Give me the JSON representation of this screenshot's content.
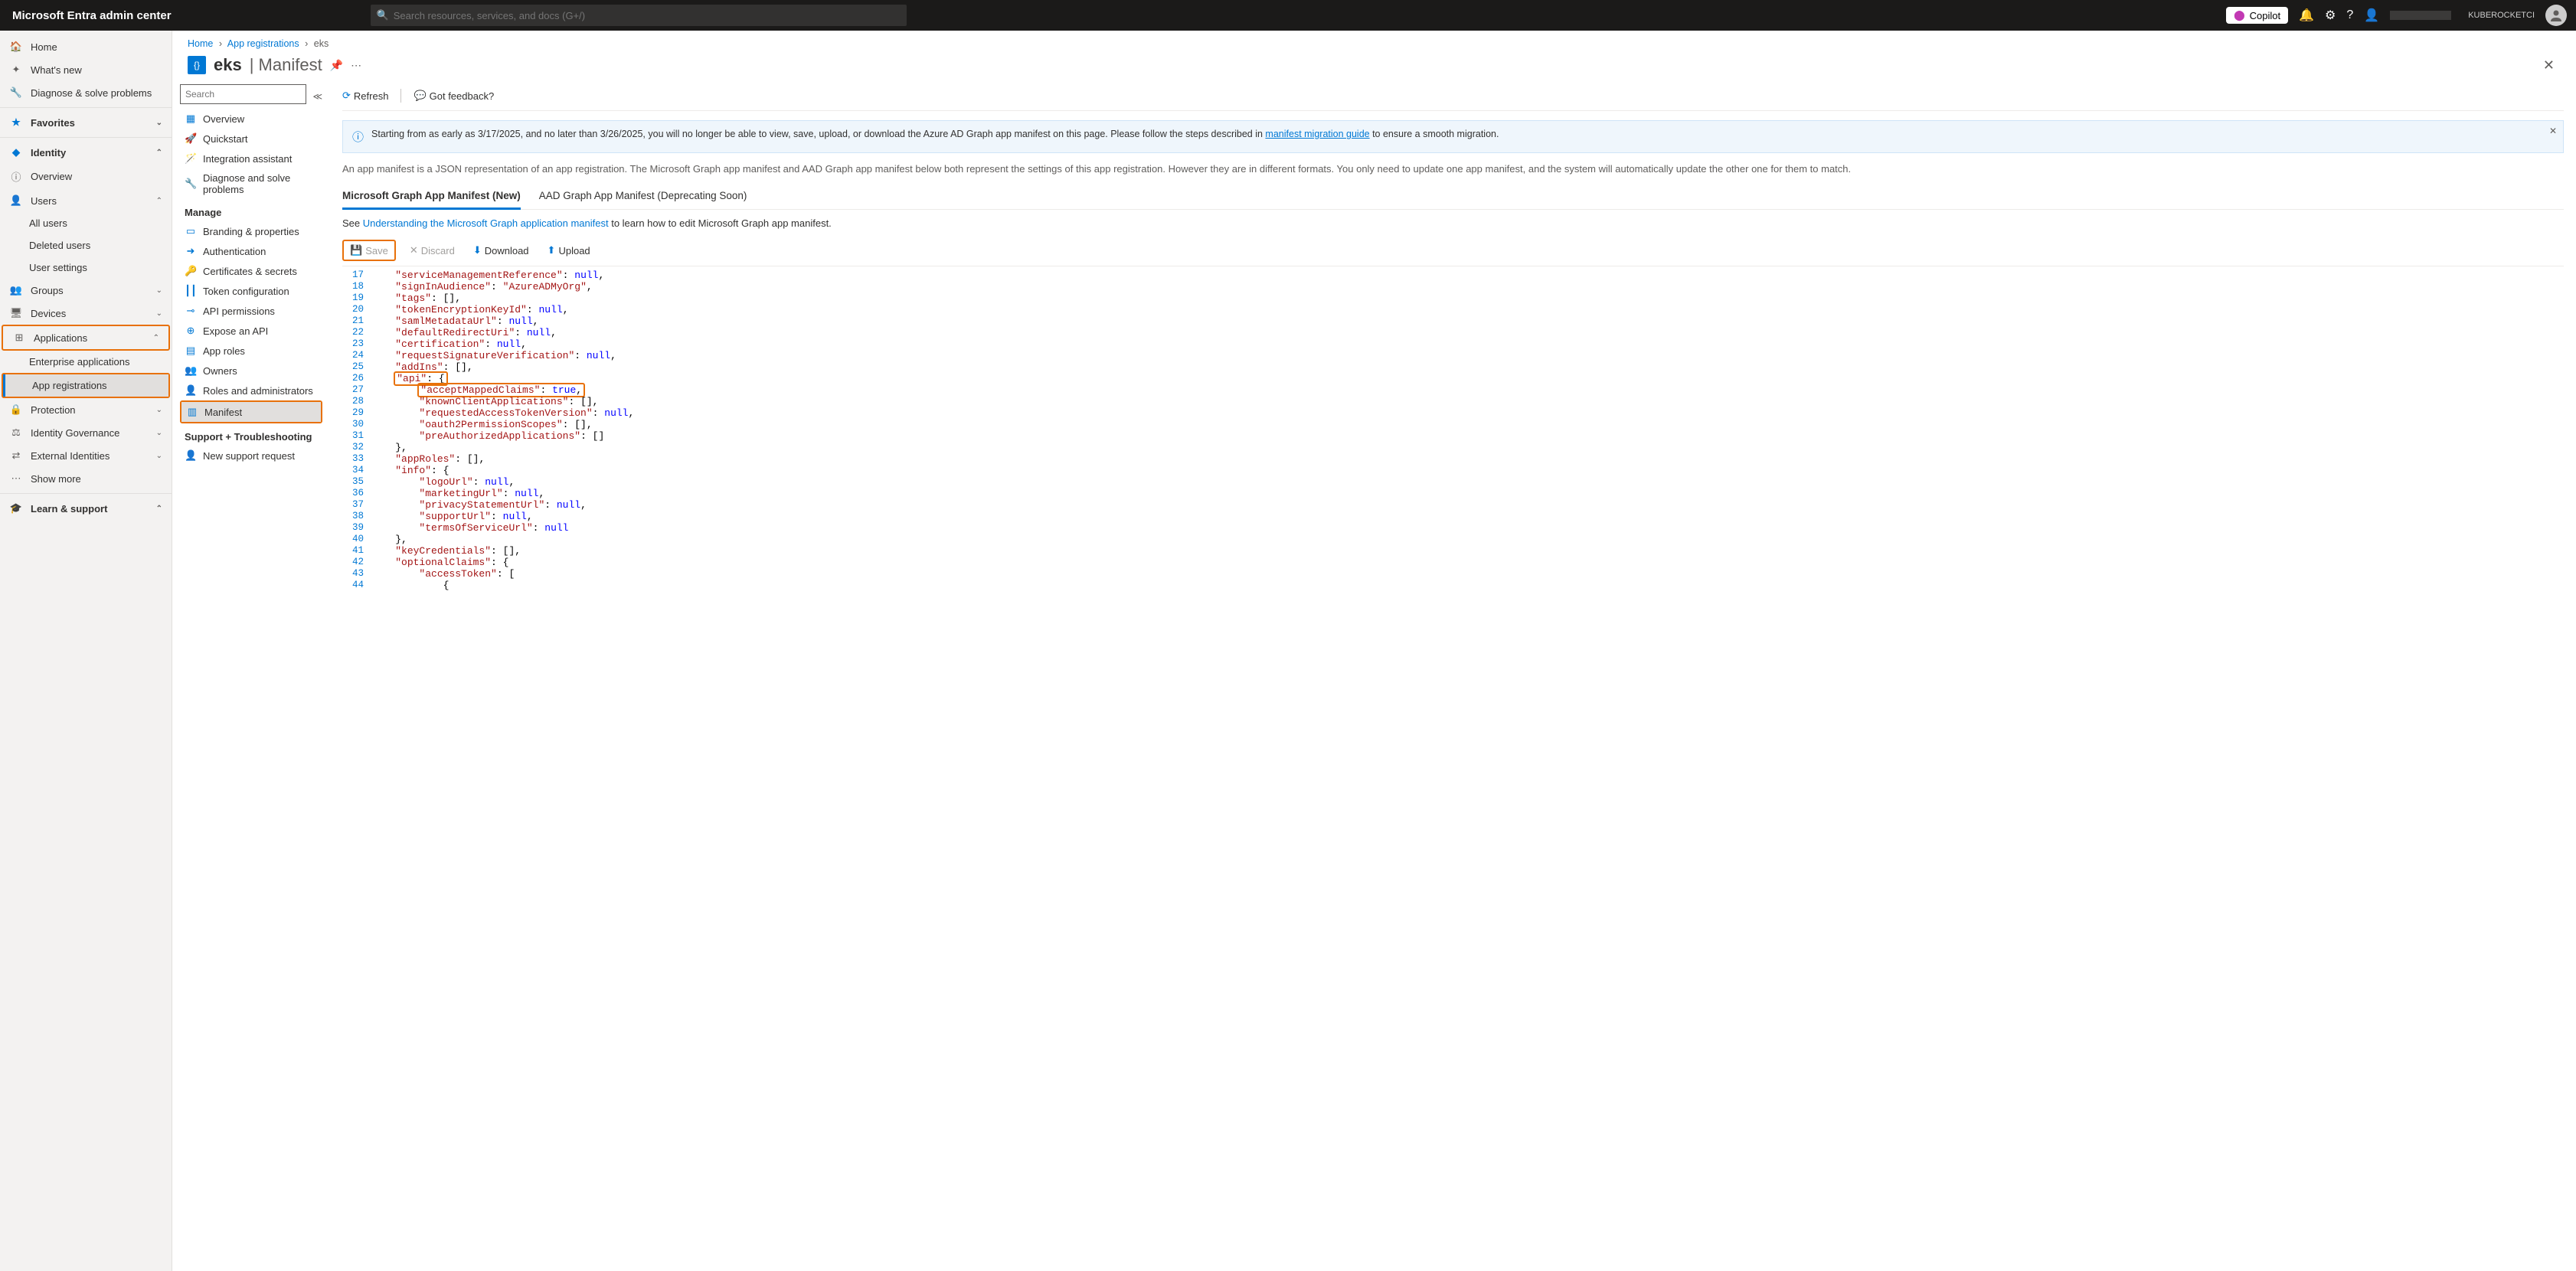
{
  "topbar": {
    "brand": "Microsoft Entra admin center",
    "search_placeholder": "Search resources, services, and docs (G+/)",
    "copilot": "Copilot",
    "tenant": "KUBEROCKETCI"
  },
  "sidebar": {
    "home": "Home",
    "whats_new": "What's new",
    "diagnose": "Diagnose & solve problems",
    "favorites": "Favorites",
    "identity": "Identity",
    "overview": "Overview",
    "users": "Users",
    "users_all": "All users",
    "users_deleted": "Deleted users",
    "users_settings": "User settings",
    "groups": "Groups",
    "devices": "Devices",
    "applications": "Applications",
    "enterprise_apps": "Enterprise applications",
    "app_registrations": "App registrations",
    "protection": "Protection",
    "identity_governance": "Identity Governance",
    "external_identities": "External Identities",
    "show_more": "Show more",
    "learn_support": "Learn & support"
  },
  "breadcrumb": {
    "home": "Home",
    "app_reg": "App registrations",
    "current": "eks"
  },
  "page": {
    "app_name": "eks",
    "section": "Manifest"
  },
  "mid": {
    "search_placeholder": "Search",
    "overview": "Overview",
    "quickstart": "Quickstart",
    "integration": "Integration assistant",
    "diagnose": "Diagnose and solve problems",
    "manage": "Manage",
    "branding": "Branding & properties",
    "authentication": "Authentication",
    "certs": "Certificates & secrets",
    "token_config": "Token configuration",
    "api_permissions": "API permissions",
    "expose_api": "Expose an API",
    "app_roles": "App roles",
    "owners": "Owners",
    "roles_admins": "Roles and administrators",
    "manifest": "Manifest",
    "support_heading": "Support + Troubleshooting",
    "new_support": "New support request"
  },
  "toolbar_right": {
    "refresh": "Refresh",
    "feedback": "Got feedback?"
  },
  "banner": {
    "text_pre": "Starting from as early as 3/17/2025, and no later than 3/26/2025, you will no longer be able to view, save, upload, or download the Azure AD Graph app manifest on this page. Please follow the steps described in ",
    "link": "manifest migration guide",
    "text_post": " to ensure a smooth migration."
  },
  "desc": "An app manifest is a JSON representation of an app registration. The Microsoft Graph app manifest and AAD Graph app manifest below both represent the settings of this app registration. However they are in different formats. You only need to update one app manifest, and the system will automatically update the other one for them to match.",
  "tabs": {
    "msgraph": "Microsoft Graph App Manifest (New)",
    "aadgraph": "AAD Graph App Manifest (Deprecating Soon)"
  },
  "learn": {
    "pre": "See ",
    "link": "Understanding the Microsoft Graph application manifest",
    "post": " to learn how to edit Microsoft Graph app manifest."
  },
  "editor_toolbar": {
    "save": "Save",
    "discard": "Discard",
    "download": "Download",
    "upload": "Upload"
  },
  "code_lines": [
    {
      "n": 17,
      "i": 1,
      "t": [
        [
          "key",
          "\"serviceManagementReference\""
        ],
        [
          "punc",
          ": "
        ],
        [
          "null",
          "null"
        ],
        [
          "punc",
          ","
        ]
      ]
    },
    {
      "n": 18,
      "i": 1,
      "t": [
        [
          "key",
          "\"signInAudience\""
        ],
        [
          "punc",
          ": "
        ],
        [
          "str",
          "\"AzureADMyOrg\""
        ],
        [
          "punc",
          ","
        ]
      ]
    },
    {
      "n": 19,
      "i": 1,
      "t": [
        [
          "key",
          "\"tags\""
        ],
        [
          "punc",
          ": [],"
        ]
      ]
    },
    {
      "n": 20,
      "i": 1,
      "t": [
        [
          "key",
          "\"tokenEncryptionKeyId\""
        ],
        [
          "punc",
          ": "
        ],
        [
          "null",
          "null"
        ],
        [
          "punc",
          ","
        ]
      ]
    },
    {
      "n": 21,
      "i": 1,
      "t": [
        [
          "key",
          "\"samlMetadataUrl\""
        ],
        [
          "punc",
          ": "
        ],
        [
          "null",
          "null"
        ],
        [
          "punc",
          ","
        ]
      ]
    },
    {
      "n": 22,
      "i": 1,
      "t": [
        [
          "key",
          "\"defaultRedirectUri\""
        ],
        [
          "punc",
          ": "
        ],
        [
          "null",
          "null"
        ],
        [
          "punc",
          ","
        ]
      ]
    },
    {
      "n": 23,
      "i": 1,
      "t": [
        [
          "key",
          "\"certification\""
        ],
        [
          "punc",
          ": "
        ],
        [
          "null",
          "null"
        ],
        [
          "punc",
          ","
        ]
      ]
    },
    {
      "n": 24,
      "i": 1,
      "t": [
        [
          "key",
          "\"requestSignatureVerification\""
        ],
        [
          "punc",
          ": "
        ],
        [
          "null",
          "null"
        ],
        [
          "punc",
          ","
        ]
      ]
    },
    {
      "n": 25,
      "i": 1,
      "t": [
        [
          "key",
          "\"addIns\""
        ],
        [
          "punc",
          ": [],"
        ]
      ]
    },
    {
      "n": 26,
      "i": 1,
      "hl": true,
      "t": [
        [
          "key",
          "\"api\""
        ],
        [
          "punc",
          ": {"
        ]
      ]
    },
    {
      "n": 27,
      "i": 2,
      "hl": true,
      "t": [
        [
          "key",
          "\"acceptMappedClaims\""
        ],
        [
          "punc",
          ": "
        ],
        [
          "bool",
          "true"
        ],
        [
          "punc",
          ","
        ]
      ]
    },
    {
      "n": 28,
      "i": 2,
      "t": [
        [
          "key",
          "\"knownClientApplications\""
        ],
        [
          "punc",
          ": [],"
        ]
      ]
    },
    {
      "n": 29,
      "i": 2,
      "t": [
        [
          "key",
          "\"requestedAccessTokenVersion\""
        ],
        [
          "punc",
          ": "
        ],
        [
          "null",
          "null"
        ],
        [
          "punc",
          ","
        ]
      ]
    },
    {
      "n": 30,
      "i": 2,
      "t": [
        [
          "key",
          "\"oauth2PermissionScopes\""
        ],
        [
          "punc",
          ": [],"
        ]
      ]
    },
    {
      "n": 31,
      "i": 2,
      "t": [
        [
          "key",
          "\"preAuthorizedApplications\""
        ],
        [
          "punc",
          ": []"
        ]
      ]
    },
    {
      "n": 32,
      "i": 1,
      "t": [
        [
          "punc",
          "},"
        ]
      ]
    },
    {
      "n": 33,
      "i": 1,
      "t": [
        [
          "key",
          "\"appRoles\""
        ],
        [
          "punc",
          ": [],"
        ]
      ]
    },
    {
      "n": 34,
      "i": 1,
      "t": [
        [
          "key",
          "\"info\""
        ],
        [
          "punc",
          ": {"
        ]
      ]
    },
    {
      "n": 35,
      "i": 2,
      "t": [
        [
          "key",
          "\"logoUrl\""
        ],
        [
          "punc",
          ": "
        ],
        [
          "null",
          "null"
        ],
        [
          "punc",
          ","
        ]
      ]
    },
    {
      "n": 36,
      "i": 2,
      "t": [
        [
          "key",
          "\"marketingUrl\""
        ],
        [
          "punc",
          ": "
        ],
        [
          "null",
          "null"
        ],
        [
          "punc",
          ","
        ]
      ]
    },
    {
      "n": 37,
      "i": 2,
      "t": [
        [
          "key",
          "\"privacyStatementUrl\""
        ],
        [
          "punc",
          ": "
        ],
        [
          "null",
          "null"
        ],
        [
          "punc",
          ","
        ]
      ]
    },
    {
      "n": 38,
      "i": 2,
      "t": [
        [
          "key",
          "\"supportUrl\""
        ],
        [
          "punc",
          ": "
        ],
        [
          "null",
          "null"
        ],
        [
          "punc",
          ","
        ]
      ]
    },
    {
      "n": 39,
      "i": 2,
      "t": [
        [
          "key",
          "\"termsOfServiceUrl\""
        ],
        [
          "punc",
          ": "
        ],
        [
          "null",
          "null"
        ]
      ]
    },
    {
      "n": 40,
      "i": 1,
      "t": [
        [
          "punc",
          "},"
        ]
      ]
    },
    {
      "n": 41,
      "i": 1,
      "t": [
        [
          "key",
          "\"keyCredentials\""
        ],
        [
          "punc",
          ": [],"
        ]
      ]
    },
    {
      "n": 42,
      "i": 1,
      "t": [
        [
          "key",
          "\"optionalClaims\""
        ],
        [
          "punc",
          ": {"
        ]
      ]
    },
    {
      "n": 43,
      "i": 2,
      "t": [
        [
          "key",
          "\"accessToken\""
        ],
        [
          "punc",
          ": ["
        ]
      ]
    },
    {
      "n": 44,
      "i": 3,
      "t": [
        [
          "punc",
          "{"
        ]
      ]
    }
  ]
}
